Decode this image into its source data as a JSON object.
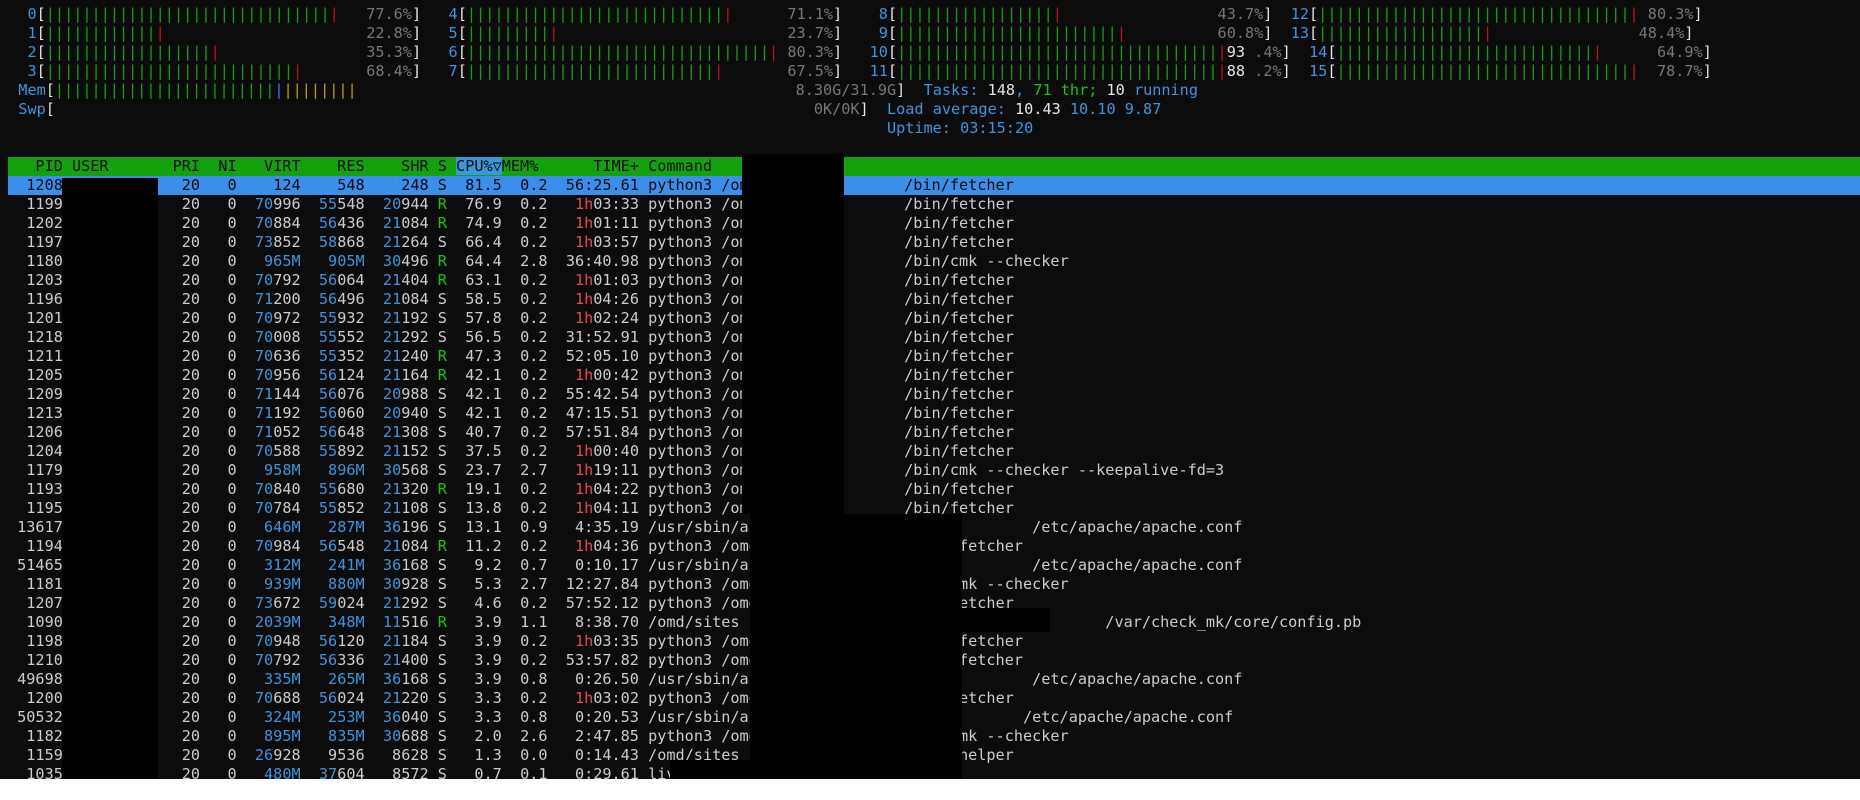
{
  "cpu_meters": [
    {
      "id": "0",
      "bar": "||||||||||||||||||||||||||||||||",
      "pct": "77.6%"
    },
    {
      "id": "1",
      "bar": "|||||||||||||",
      "pct": "22.8%"
    },
    {
      "id": "2",
      "bar": "|||||||||||||||||||",
      "pct": "35.3%"
    },
    {
      "id": "3",
      "bar": "||||||||||||||||||||||||||||",
      "pct": "68.4%"
    },
    {
      "id": "4",
      "bar": "|||||||||||||||||||||||||||||",
      "pct": "71.1%"
    },
    {
      "id": "5",
      "bar": "||||||||||",
      "pct": "23.7%"
    },
    {
      "id": "6",
      "bar": "||||||||||||||||||||||||||||||||||",
      "pct": "80.3%"
    },
    {
      "id": "7",
      "bar": "||||||||||||||||||||||||||||",
      "pct": "67.5%"
    },
    {
      "id": "8",
      "bar": "||||||||||||||||||",
      "pct": "43.7%"
    },
    {
      "id": "9",
      "bar": "|||||||||||||||||||||||||",
      "pct": "60.8%"
    },
    {
      "id": "10",
      "bar": "||||||||||||||||||||||||||||||||||||93",
      "pct": ".4%"
    },
    {
      "id": "11",
      "bar": "||||||||||||||||||||||||||||||||||||88",
      "pct": ".2%"
    },
    {
      "id": "12",
      "bar": "|||||||||||||||||||||||||||||||||||",
      "pct": "80.3%"
    },
    {
      "id": "13",
      "bar": "|||||||||||||||||||",
      "pct": "48.4%"
    },
    {
      "id": "14",
      "bar": "|||||||||||||||||||||||||||||",
      "pct": "64.9%"
    },
    {
      "id": "15",
      "bar": "|||||||||||||||||||||||||||||||||",
      "pct": "78.7%"
    }
  ],
  "mem": {
    "label": "Mem",
    "value": "8.30G/31.9G"
  },
  "swp": {
    "label": "Swp",
    "value": "0K/0K"
  },
  "tasks": {
    "label": "Tasks:",
    "count": "148",
    "thr": "71 thr;",
    "running": "10 running"
  },
  "load": {
    "label": "Load average:",
    "v1": "10.43",
    "v2": "10.10",
    "v3": "9.87"
  },
  "uptime": {
    "label": "Uptime:",
    "value": "03:15:20"
  },
  "columns": [
    "PID",
    "USER",
    "PRI",
    "NI",
    "VIRT",
    "RES",
    "SHR",
    "S",
    "CPU%▽",
    "MEM%",
    "TIME+",
    "Command"
  ],
  "processes": [
    {
      "pid": "1208",
      "pri": "20",
      "ni": "0",
      "virt": "71124",
      "res": "56548",
      "shr": "21248",
      "s": "S",
      "cpu": "81.5",
      "mem": "0.2",
      "time": "56:25.61",
      "cmd": "python3 /omd/sites          /bin/fetcher"
    },
    {
      "pid": "1199",
      "pri": "20",
      "ni": "0",
      "virt": "70996",
      "res": "55548",
      "shr": "20944",
      "s": "R",
      "cpu": "76.9",
      "mem": "0.2",
      "time": "1h03:33",
      "cmd": "python3 /omd/sites          /bin/fetcher"
    },
    {
      "pid": "1202",
      "pri": "20",
      "ni": "0",
      "virt": "70884",
      "res": "56436",
      "shr": "21084",
      "s": "R",
      "cpu": "74.9",
      "mem": "0.2",
      "time": "1h01:11",
      "cmd": "python3 /omd/sites          /bin/fetcher"
    },
    {
      "pid": "1197",
      "pri": "20",
      "ni": "0",
      "virt": "73852",
      "res": "58868",
      "shr": "21264",
      "s": "S",
      "cpu": "66.4",
      "mem": "0.2",
      "time": "1h03:57",
      "cmd": "python3 /omd/sites          /bin/fetcher"
    },
    {
      "pid": "1180",
      "pri": "20",
      "ni": "0",
      "virt": "965M",
      "res": "905M",
      "shr": "30496",
      "s": "R",
      "cpu": "64.4",
      "mem": "2.8",
      "time": "36:40.98",
      "cmd": "python3 /omd/sites          /bin/cmk --checker"
    },
    {
      "pid": "1203",
      "pri": "20",
      "ni": "0",
      "virt": "70792",
      "res": "56064",
      "shr": "21404",
      "s": "R",
      "cpu": "63.1",
      "mem": "0.2",
      "time": "1h01:03",
      "cmd": "python3 /omd/sites          /bin/fetcher"
    },
    {
      "pid": "1196",
      "pri": "20",
      "ni": "0",
      "virt": "71200",
      "res": "56496",
      "shr": "21084",
      "s": "S",
      "cpu": "58.5",
      "mem": "0.2",
      "time": "1h04:26",
      "cmd": "python3 /omd/sites          /bin/fetcher"
    },
    {
      "pid": "1201",
      "pri": "20",
      "ni": "0",
      "virt": "70972",
      "res": "55932",
      "shr": "21192",
      "s": "S",
      "cpu": "57.8",
      "mem": "0.2",
      "time": "1h02:24",
      "cmd": "python3 /omd/sites          /bin/fetcher"
    },
    {
      "pid": "1218",
      "pri": "20",
      "ni": "0",
      "virt": "70008",
      "res": "55552",
      "shr": "21292",
      "s": "S",
      "cpu": "56.5",
      "mem": "0.2",
      "time": "31:52.91",
      "cmd": "python3 /omd/sites          /bin/fetcher"
    },
    {
      "pid": "1211",
      "pri": "20",
      "ni": "0",
      "virt": "70636",
      "res": "55352",
      "shr": "21240",
      "s": "R",
      "cpu": "47.3",
      "mem": "0.2",
      "time": "52:05.10",
      "cmd": "python3 /omd/sites          /bin/fetcher"
    },
    {
      "pid": "1205",
      "pri": "20",
      "ni": "0",
      "virt": "70956",
      "res": "56124",
      "shr": "21164",
      "s": "R",
      "cpu": "42.1",
      "mem": "0.2",
      "time": "1h00:42",
      "cmd": "python3 /omd/sites          /bin/fetcher"
    },
    {
      "pid": "1209",
      "pri": "20",
      "ni": "0",
      "virt": "71144",
      "res": "56076",
      "shr": "20988",
      "s": "S",
      "cpu": "42.1",
      "mem": "0.2",
      "time": "55:42.54",
      "cmd": "python3 /omd/sites          /bin/fetcher"
    },
    {
      "pid": "1213",
      "pri": "20",
      "ni": "0",
      "virt": "71192",
      "res": "56060",
      "shr": "20940",
      "s": "S",
      "cpu": "42.1",
      "mem": "0.2",
      "time": "47:15.51",
      "cmd": "python3 /omd/sites          /bin/fetcher"
    },
    {
      "pid": "1206",
      "pri": "20",
      "ni": "0",
      "virt": "71052",
      "res": "56648",
      "shr": "21308",
      "s": "S",
      "cpu": "40.7",
      "mem": "0.2",
      "time": "57:51.84",
      "cmd": "python3 /omd/sites          /bin/fetcher"
    },
    {
      "pid": "1204",
      "pri": "20",
      "ni": "0",
      "virt": "70588",
      "res": "55892",
      "shr": "21152",
      "s": "S",
      "cpu": "37.5",
      "mem": "0.2",
      "time": "1h00:40",
      "cmd": "python3 /omd/sites          /bin/fetcher"
    },
    {
      "pid": "1179",
      "pri": "20",
      "ni": "0",
      "virt": "958M",
      "res": "896M",
      "shr": "30568",
      "s": "S",
      "cpu": "23.7",
      "mem": "2.7",
      "time": "1h19:11",
      "cmd": "python3 /omd/sites          /bin/cmk --checker --keepalive-fd=3"
    },
    {
      "pid": "1193",
      "pri": "20",
      "ni": "0",
      "virt": "70840",
      "res": "55680",
      "shr": "21320",
      "s": "R",
      "cpu": "19.1",
      "mem": "0.2",
      "time": "1h04:22",
      "cmd": "python3 /omd/sites          /bin/fetcher"
    },
    {
      "pid": "1195",
      "pri": "20",
      "ni": "0",
      "virt": "70784",
      "res": "55852",
      "shr": "21108",
      "s": "S",
      "cpu": "13.8",
      "mem": "0.2",
      "time": "1h04:11",
      "cmd": "python3 /omd/sites          /bin/fetcher"
    },
    {
      "pid": "13617",
      "pri": "20",
      "ni": "0",
      "virt": "646M",
      "res": "287M",
      "shr": "36196",
      "s": "S",
      "cpu": "13.1",
      "mem": "0.9",
      "time": "4:35.19",
      "cmd": "/usr/sbin/apache2 -f /omd/sites/          /etc/apache/apache.conf"
    },
    {
      "pid": "1194",
      "pri": "20",
      "ni": "0",
      "virt": "70984",
      "res": "56548",
      "shr": "21084",
      "s": "R",
      "cpu": "11.2",
      "mem": "0.2",
      "time": "1h04:36",
      "cmd": "python3 /omd/sites/          /bin/fetcher"
    },
    {
      "pid": "51465",
      "pri": "20",
      "ni": "0",
      "virt": "312M",
      "res": "241M",
      "shr": "36168",
      "s": "S",
      "cpu": "9.2",
      "mem": "0.7",
      "time": "0:10.17",
      "cmd": "/usr/sbin/apache2 -f /omd/sites/          /etc/apache/apache.conf"
    },
    {
      "pid": "1181",
      "pri": "20",
      "ni": "0",
      "virt": "939M",
      "res": "880M",
      "shr": "30928",
      "s": "S",
      "cpu": "5.3",
      "mem": "2.7",
      "time": "12:27.84",
      "cmd": "python3 /omd/sites          /bin/cmk --checker"
    },
    {
      "pid": "1207",
      "pri": "20",
      "ni": "0",
      "virt": "73672",
      "res": "59024",
      "shr": "21292",
      "s": "S",
      "cpu": "4.6",
      "mem": "0.2",
      "time": "57:52.12",
      "cmd": "python3 /omd/sites          /bin/fetcher"
    },
    {
      "pid": "1090",
      "pri": "20",
      "ni": "0",
      "virt": "2039M",
      "res": "348M",
      "shr": "11516",
      "s": "R",
      "cpu": "3.9",
      "mem": "1.1",
      "time": "8:38.70",
      "cmd": "/omd/sites          /bin/cmc /omd/sites/          /var/check_mk/core/config.pb"
    },
    {
      "pid": "1198",
      "pri": "20",
      "ni": "0",
      "virt": "70948",
      "res": "56120",
      "shr": "21184",
      "s": "S",
      "cpu": "3.9",
      "mem": "0.2",
      "time": "1h03:35",
      "cmd": "python3 /omd/sites/          /bin/fetcher"
    },
    {
      "pid": "1210",
      "pri": "20",
      "ni": "0",
      "virt": "70792",
      "res": "56336",
      "shr": "21400",
      "s": "S",
      "cpu": "3.9",
      "mem": "0.2",
      "time": "53:57.82",
      "cmd": "python3 /omd/sites/          /bin/fetcher"
    },
    {
      "pid": "49698",
      "pri": "20",
      "ni": "0",
      "virt": "335M",
      "res": "265M",
      "shr": "36168",
      "s": "S",
      "cpu": "3.9",
      "mem": "0.8",
      "time": "0:26.50",
      "cmd": "/usr/sbin/apache2 -f /omd/sites/          /etc/apache/apache.conf"
    },
    {
      "pid": "1200",
      "pri": "20",
      "ni": "0",
      "virt": "70688",
      "res": "56024",
      "shr": "21220",
      "s": "S",
      "cpu": "3.3",
      "mem": "0.2",
      "time": "1h03:02",
      "cmd": "python3 /omd/sites          /bin/fetcher"
    },
    {
      "pid": "50532",
      "pri": "20",
      "ni": "0",
      "virt": "324M",
      "res": "253M",
      "shr": "36040",
      "s": "S",
      "cpu": "3.3",
      "mem": "0.8",
      "time": "0:20.53",
      "cmd": "/usr/sbin/apache2 -f /omd/sites          /etc/apache/apache.conf"
    },
    {
      "pid": "1182",
      "pri": "20",
      "ni": "0",
      "virt": "895M",
      "res": "835M",
      "shr": "30688",
      "s": "S",
      "cpu": "2.0",
      "mem": "2.6",
      "time": "2:47.85",
      "cmd": "python3 /omd/sites          /bin/cmk --checker"
    },
    {
      "pid": "1159",
      "pri": "20",
      "ni": "0",
      "virt": "26928",
      "res": "9536",
      "shr": "8628",
      "s": "S",
      "cpu": "1.3",
      "mem": "0.0",
      "time": "0:14.43",
      "cmd": "/omd/sites          /lib/cmc/checkhelper"
    },
    {
      "pid": "1035",
      "pri": "20",
      "ni": "0",
      "virt": "480M",
      "res": "37604",
      "shr": "8572",
      "s": "S",
      "cpu": "0.7",
      "mem": "0.1",
      "time": "0:29.61",
      "cmd": "liveproxyd"
    }
  ],
  "colors": {
    "bar_green": "#13a10e",
    "bar_red": "#c50f1f",
    "header_bg": "#13a10e",
    "selected_bg": "#3b8eea",
    "label_cyan": "#3a96dd"
  }
}
